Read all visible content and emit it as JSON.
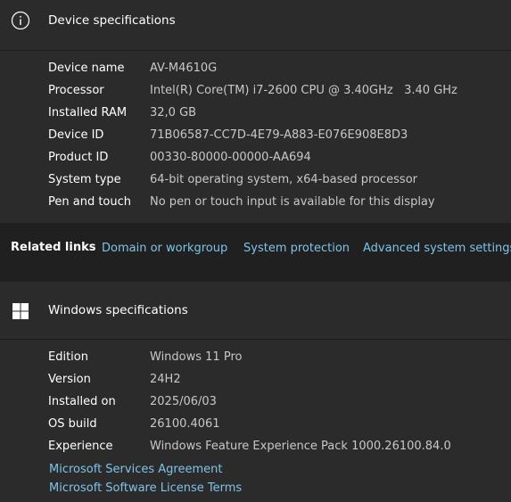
{
  "device_specs": {
    "icon": "info-icon",
    "title": "Device specifications",
    "rows": [
      {
        "label": "Device name",
        "value": "AV-M4610G"
      },
      {
        "label": "Processor",
        "value": "Intel(R) Core(TM) i7-2600 CPU @ 3.40GHz   3.40 GHz"
      },
      {
        "label": "Installed RAM",
        "value": "32,0 GB"
      },
      {
        "label": "Device ID",
        "value": "71B06587-CC7D-4E79-A883-E076E908E8D3"
      },
      {
        "label": "Product ID",
        "value": "00330-80000-00000-AA694"
      },
      {
        "label": "System type",
        "value": "64-bit operating system, x64-based processor"
      },
      {
        "label": "Pen and touch",
        "value": "No pen or touch input is available for this display"
      }
    ]
  },
  "related_links": {
    "title": "Related links",
    "links": [
      "Domain or workgroup",
      "System protection",
      "Advanced system settings"
    ]
  },
  "windows_specs": {
    "icon": "windows-logo-icon",
    "title": "Windows specifications",
    "rows": [
      {
        "label": "Edition",
        "value": "Windows 11 Pro"
      },
      {
        "label": "Version",
        "value": "24H2"
      },
      {
        "label": "Installed on",
        "value": "2025/06/03"
      },
      {
        "label": "OS build",
        "value": "26100.4061"
      },
      {
        "label": "Experience",
        "value": "Windows Feature Experience Pack 1000.26100.84.0"
      }
    ],
    "links": [
      "Microsoft Services Agreement",
      "Microsoft Software License Terms"
    ]
  },
  "colors": {
    "background": "#202020",
    "card": "#2b2b2b",
    "link": "#7fc3ea",
    "value_text": "#c8c8c8"
  }
}
